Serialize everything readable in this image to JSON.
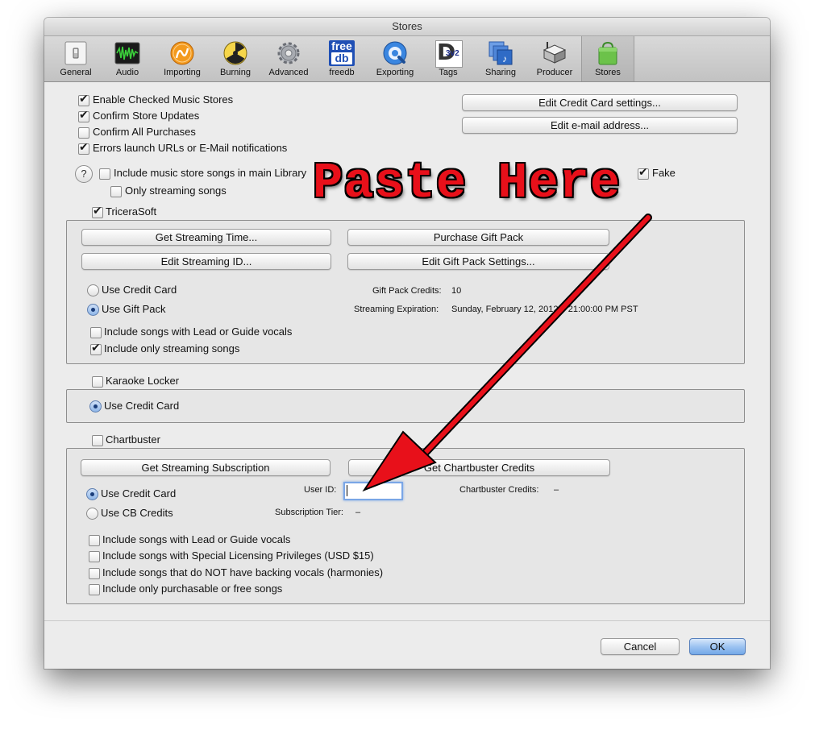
{
  "window": {
    "title": "Stores"
  },
  "toolbar": {
    "items": [
      {
        "label": "General",
        "icon": "general-switch-icon"
      },
      {
        "label": "Audio",
        "icon": "audio-waveform-icon"
      },
      {
        "label": "Importing",
        "icon": "importing-icon"
      },
      {
        "label": "Burning",
        "icon": "burning-radiation-icon"
      },
      {
        "label": "Advanced",
        "icon": "advanced-gear-icon"
      },
      {
        "label": "freedb",
        "icon": "freedb-icon",
        "icon_text_top": "free",
        "icon_text_bottom": "db"
      },
      {
        "label": "Exporting",
        "icon": "exporting-icon"
      },
      {
        "label": "Tags",
        "icon": "tags-icon",
        "icon_text": "3v2"
      },
      {
        "label": "Sharing",
        "icon": "sharing-icon"
      },
      {
        "label": "Producer",
        "icon": "producer-icon"
      },
      {
        "label": "Stores",
        "icon": "stores-bag-icon"
      }
    ],
    "selected": "Stores"
  },
  "general": {
    "enable_checked_stores": {
      "label": "Enable Checked Music Stores",
      "checked": true
    },
    "confirm_store_updates": {
      "label": "Confirm Store Updates",
      "checked": true
    },
    "confirm_all_purchases": {
      "label": "Confirm All Purchases",
      "checked": false
    },
    "errors_launch_urls": {
      "label": "Errors launch URLs or E-Mail notifications",
      "checked": true
    },
    "edit_credit_card_button": "Edit Credit Card settings...",
    "edit_email_button": "Edit e-mail address...",
    "help_symbol": "?",
    "include_store_songs": {
      "label": "Include music store songs in main Library",
      "checked": false
    },
    "only_streaming_songs": {
      "label": "Only streaming songs",
      "checked": false
    },
    "fake": {
      "label": "Fake",
      "checked": true
    }
  },
  "triccerasoft": {
    "enabled": {
      "label": "TriceraSoft",
      "checked": true
    },
    "buttons": {
      "get_streaming_time": "Get Streaming Time...",
      "purchase_gift_pack": "Purchase Gift Pack",
      "edit_streaming_id": "Edit Streaming ID...",
      "edit_gift_pack_settings": "Edit Gift Pack Settings..."
    },
    "payment": {
      "use_credit_card": "Use Credit Card",
      "use_gift_pack": "Use Gift Pack",
      "selected": "Use Gift Pack"
    },
    "gift_pack_credits_label": "Gift Pack Credits:",
    "gift_pack_credits_value": "10",
    "streaming_expiration_label": "Streaming Expiration:",
    "streaming_expiration_value": "Sunday, February 12, 2012 – 21:00:00 PM PST",
    "include_lead_vocals": {
      "label": "Include songs with Lead or Guide vocals",
      "checked": false
    },
    "include_only_streaming": {
      "label": "Include only streaming songs",
      "checked": true
    }
  },
  "karaoke_locker": {
    "enabled": {
      "label": "Karaoke Locker",
      "checked": false
    },
    "use_credit_card": "Use Credit Card",
    "selected": "Use Credit Card"
  },
  "chartbuster": {
    "enabled": {
      "label": "Chartbuster",
      "checked": false
    },
    "get_streaming_subscription_button": "Get Streaming Subscription",
    "get_chartbuster_credits_button": "Get Chartbuster Credits",
    "payment": {
      "use_credit_card": "Use Credit Card",
      "use_cb_credits": "Use CB Credits",
      "selected": "Use Credit Card"
    },
    "user_id_label": "User ID:",
    "user_id_value": "",
    "chartbuster_credits_label": "Chartbuster Credits:",
    "chartbuster_credits_value": "–",
    "subscription_tier_label": "Subscription Tier:",
    "subscription_tier_value": "–",
    "include_lead_vocals": {
      "label": "Include songs with Lead or Guide vocals",
      "checked": false
    },
    "include_special_licensing": {
      "label": "Include songs with Special Licensing Privileges (USD $15)",
      "checked": false
    },
    "include_no_backing_vocals": {
      "label": "Include songs that do NOT have backing vocals (harmonies)",
      "checked": false
    },
    "include_purchasable_free": {
      "label": "Include only purchasable or free songs",
      "checked": false
    }
  },
  "footer": {
    "cancel": "Cancel",
    "ok": "OK"
  },
  "annotation": {
    "text": "Paste Here",
    "color": "#e8101a"
  }
}
